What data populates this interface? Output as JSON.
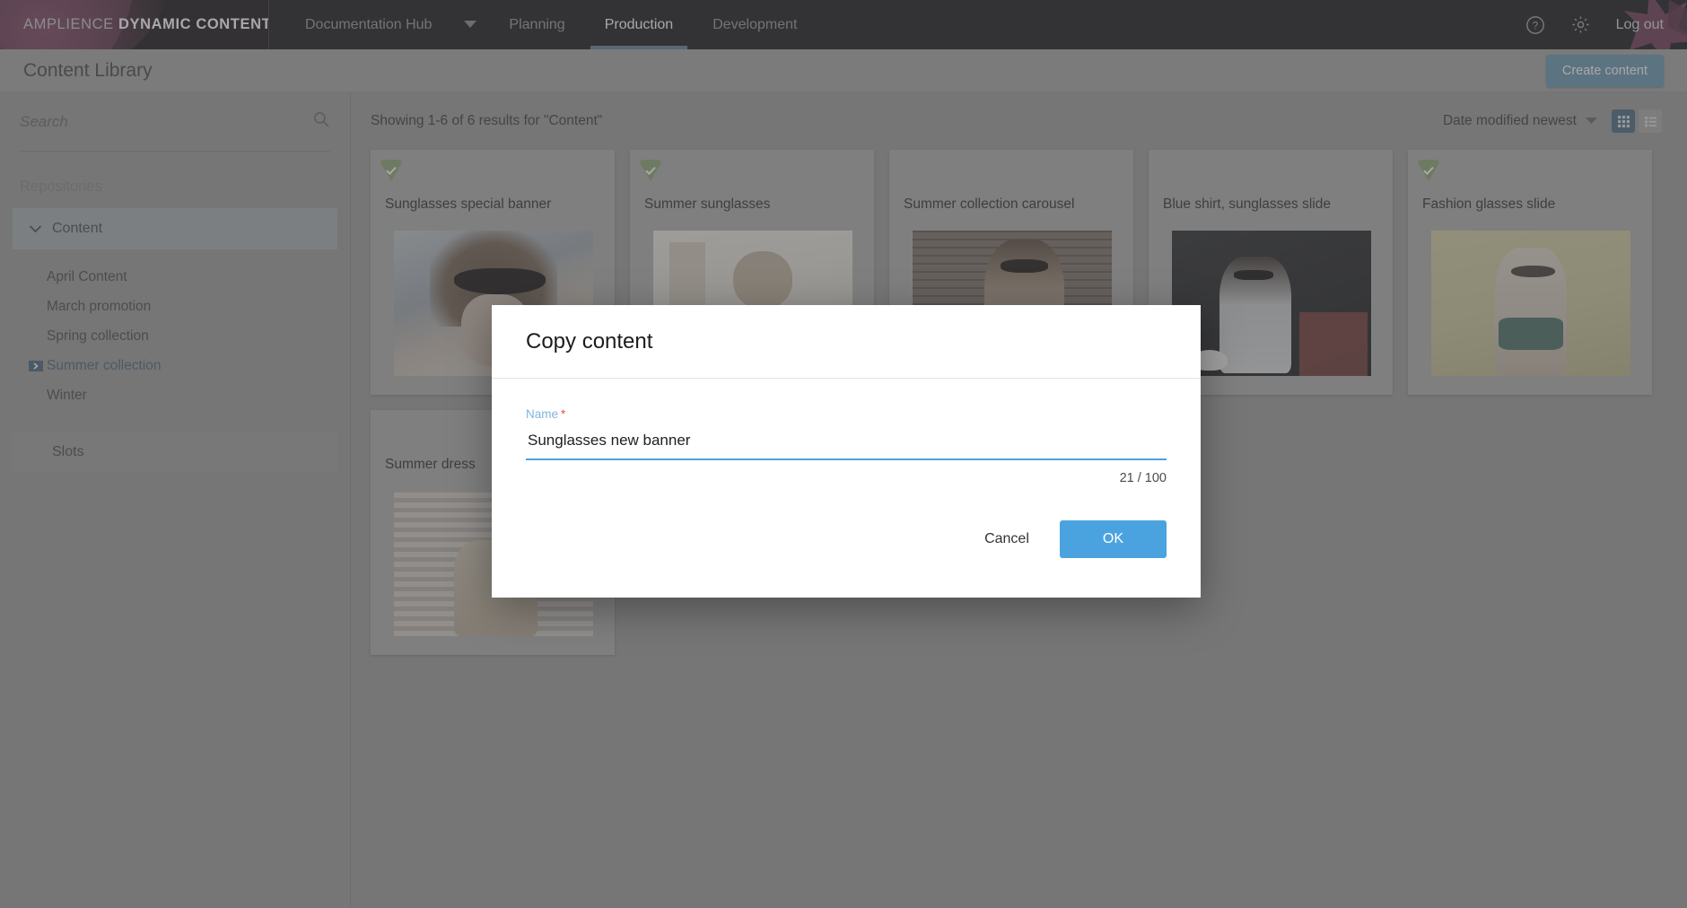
{
  "topbar": {
    "brand_prefix": "AMPLIENCE ",
    "brand_strong": "DYNAMIC CONTENT",
    "nav": [
      {
        "label": "Documentation Hub",
        "active": false
      },
      {
        "label": "Planning",
        "active": false
      },
      {
        "label": "Production",
        "active": true
      },
      {
        "label": "Development",
        "active": false
      }
    ],
    "help_icon": "help-circle-icon",
    "settings_icon": "gear-icon",
    "logout_label": "Log out"
  },
  "subheader": {
    "page_title": "Content Library",
    "create_button": "Create content"
  },
  "sidebar": {
    "search_placeholder": "Search",
    "search_value": "",
    "search_icon": "search-icon",
    "section_label": "Repositories",
    "repository": {
      "label": "Content",
      "expanded": true,
      "chevron": "chevron-down-icon"
    },
    "children": [
      {
        "label": "April Content",
        "selected": false
      },
      {
        "label": "March promotion",
        "selected": false
      },
      {
        "label": "Spring collection",
        "selected": false
      },
      {
        "label": "Summer collection",
        "selected": true
      },
      {
        "label": "Winter",
        "selected": false
      }
    ],
    "slots_label": "Slots"
  },
  "main": {
    "results_text": "Showing 1-6 of 6 results for \"Content\"",
    "sort_label": "Date modified newest",
    "sort_chevron": "chevron-down-icon",
    "view_grid_icon": "grid-view-icon",
    "view_list_icon": "list-view-icon",
    "active_view": "grid",
    "cards": [
      {
        "title": "Sunglasses special banner",
        "published": true,
        "theme": "beach-portrait"
      },
      {
        "title": "Summer sunglasses",
        "published": true,
        "theme": "bright-indoor"
      },
      {
        "title": "Summer collection carousel",
        "published": false,
        "theme": "brick-wall"
      },
      {
        "title": "Blue shirt, sunglasses slide",
        "published": false,
        "theme": "dark-cafe"
      },
      {
        "title": "Fashion glasses slide",
        "published": true,
        "theme": "yellow-wall"
      },
      {
        "title": "Summer dress",
        "published": false,
        "theme": "pale-stripe"
      }
    ]
  },
  "modal": {
    "title": "Copy content",
    "field_label": "Name",
    "required_mark": "*",
    "name_value": "Sunglasses new banner",
    "name_placeholder": "",
    "counter": "21 / 100",
    "cancel_label": "Cancel",
    "ok_label": "OK"
  },
  "colors": {
    "accent_blue": "#4aa3df",
    "nav_underline": "#4a87b8",
    "published_green": "#7fb04a",
    "required_red": "#e2563d",
    "brand_magenta": "#a8326f",
    "topbar_bg": "#1e1e27",
    "selected_repo": "#9fb3bd"
  }
}
